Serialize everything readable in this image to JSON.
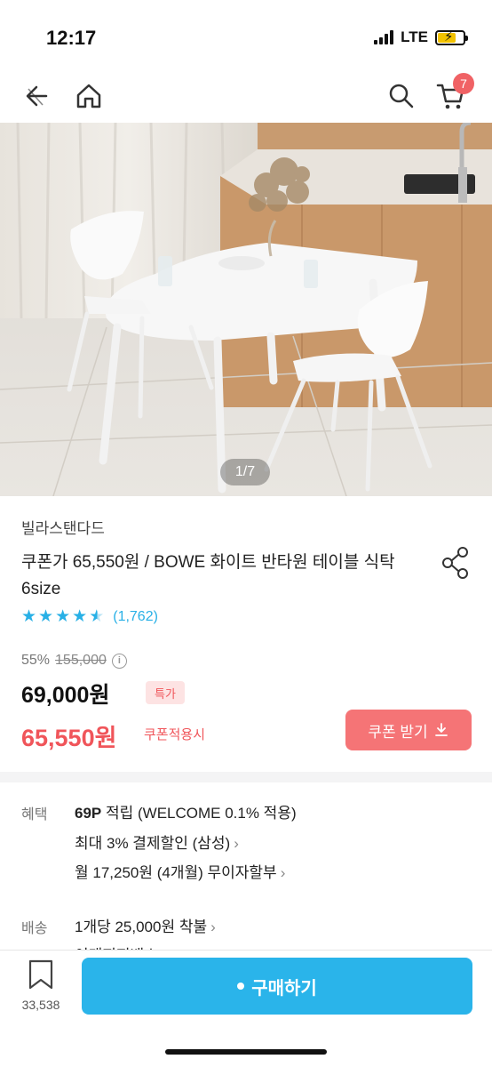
{
  "status": {
    "time": "12:17",
    "network": "LTE"
  },
  "nav": {
    "cart_count": "7"
  },
  "hero": {
    "counter": "1/7"
  },
  "product": {
    "brand": "빌라스탠다드",
    "title": "쿠폰가 65,550원 / BOWE 화이트 반타원 테이블 식탁 6size",
    "rating": 4.5,
    "review_count": "(1,762)",
    "discount": "55%",
    "original_price": "155,000",
    "sale_price": "69,000원",
    "special_badge": "특가",
    "coupon_price": "65,550원",
    "coupon_note": "쿠폰적용시",
    "coupon_button": "쿠폰 받기"
  },
  "benefits": {
    "label": "혜택",
    "points_amount": "69P",
    "points_text": "적립 (WELCOME 0.1% 적용)",
    "card_discount": "최대 3% 결제할인 (삼성)",
    "installment": "월 17,250원 (4개월) 무이자할부"
  },
  "shipping": {
    "label": "배송",
    "fee": "1개당 25,000원 착불",
    "next_line": "이태지지배소"
  },
  "bottom": {
    "bookmark_count": "33,538",
    "buy_button": "구매하기"
  },
  "colors": {
    "accent": "#2ab4ea",
    "coupon": "#f57476",
    "price_red": "#f0555a",
    "star": "#28b0e6"
  }
}
